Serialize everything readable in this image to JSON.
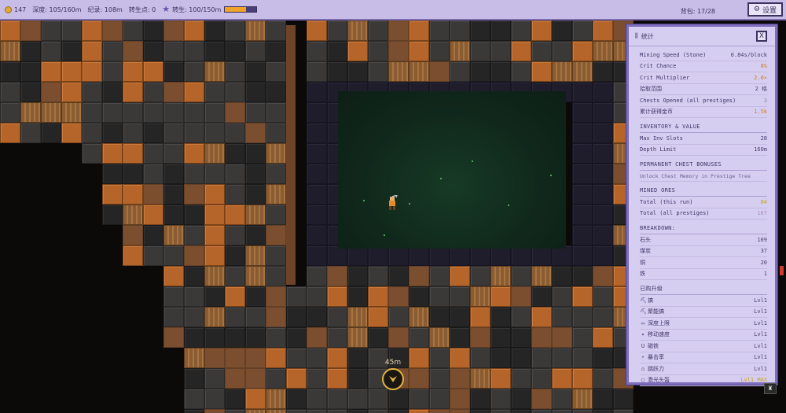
{
  "topbar": {
    "coins": "147",
    "depth": "深度: 105/160m",
    "record": "纪录: 108m",
    "prestige_points": "转生点: 0",
    "prestige_progress": "转生: 100/150m",
    "prestige_fraction": 0.667,
    "bag": "背包: 17/28",
    "settings_label": "设置"
  },
  "game": {
    "depth_marker": "45m"
  },
  "stats": {
    "title": "统计",
    "close_label": "X",
    "general": [
      {
        "label": "Mining Speed (Stone)",
        "value": "0.84s/block"
      },
      {
        "label": "Crit Chance",
        "value": "8%"
      },
      {
        "label": "Crit Multiplier",
        "value": "2.0×"
      },
      {
        "label": "拾取范围",
        "value": "2 格"
      },
      {
        "label": "Chests Opened (all prestiges)",
        "value": "3"
      },
      {
        "label": "累计获得金币",
        "value": "1.5k"
      }
    ],
    "inventory_title": "INVENTORY & VALUE",
    "inventory": [
      {
        "label": "Max Inv Slots",
        "value": "28"
      },
      {
        "label": "Depth Limit",
        "value": "160m"
      }
    ],
    "chest_title": "PERMANENT CHEST BONUSES",
    "chest_note": "Unlock Chest Memory in Prestige Tree",
    "mined_title": "MINED ORES",
    "mined": [
      {
        "label": "Total (this run)",
        "value": "84"
      },
      {
        "label": "Total (all prestiges)",
        "value": "167"
      }
    ],
    "breakdown_title": "BREAKDOWN:",
    "breakdown": [
      {
        "label": "石头",
        "value": "109"
      },
      {
        "label": "煤炭",
        "value": "37"
      },
      {
        "label": "铜",
        "value": "20"
      },
      {
        "label": "铁",
        "value": "1"
      }
    ],
    "upgrades_title": "已购升级",
    "upgrades": [
      {
        "icon": "pickaxe-icon",
        "glyph": "⛏",
        "label": "镐",
        "value": "Lvl1"
      },
      {
        "icon": "drill-pickaxe-icon",
        "glyph": "⛏",
        "label": "聚能镐",
        "value": "Lvl1"
      },
      {
        "icon": "depth-icon",
        "glyph": "▭",
        "label": "深度上限",
        "value": "Lvl1"
      },
      {
        "icon": "boot-icon",
        "glyph": "✦",
        "label": "移动速度",
        "value": "Lvl1"
      },
      {
        "icon": "magnet-icon",
        "glyph": "U",
        "label": "磁铁",
        "value": "Lvl1"
      },
      {
        "icon": "lightning-icon",
        "glyph": "⚡",
        "label": "暴击率",
        "value": "Lvl1"
      },
      {
        "icon": "jump-icon",
        "glyph": "⌂",
        "label": "跳跃力",
        "value": "Lvl1"
      },
      {
        "icon": "headlamp-icon",
        "glyph": "▢",
        "label": "激光头盔",
        "value": "Lvl1 MAX"
      }
    ]
  },
  "colors": {
    "panel_bg": "#d6cef0",
    "panel_border": "#7e6cbc",
    "topbar_bg": "#c7bde6",
    "copper": "#b5652a",
    "chamber": "#173a26",
    "accent_gold": "#e1b43c"
  }
}
